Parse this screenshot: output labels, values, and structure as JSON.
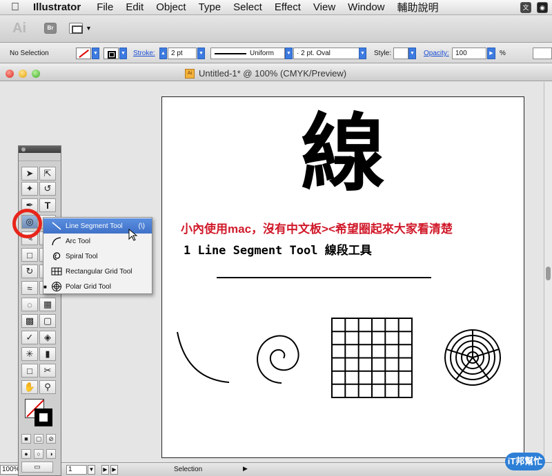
{
  "menubar": {
    "app_name": "Illustrator",
    "items": [
      "File",
      "Edit",
      "Object",
      "Type",
      "Select",
      "Effect",
      "View",
      "Window",
      "輔助說明"
    ]
  },
  "appbar": {
    "logo": "Ai",
    "bridge": "Br"
  },
  "controlbar": {
    "selection_status": "No Selection",
    "stroke_label": "Stroke:",
    "stroke_weight": "2 pt",
    "brush_label": "Uniform",
    "profile": "·   2 pt. Oval",
    "style_label": "Style:",
    "opacity_label": "Opacity:",
    "opacity_value": "100",
    "opacity_unit": "%"
  },
  "document": {
    "title": "Untitled-1* @ 100% (CMYK/Preview)",
    "icon": "Ai"
  },
  "artboard": {
    "big_char": "線",
    "red_text": "小內使用mac，沒有中文板><希望圈起來大家看清楚",
    "subtitle": "1 Line Segment Tool 線段工具"
  },
  "flyout": {
    "items": [
      {
        "label": "Line Segment Tool",
        "shortcut": "(\\)",
        "icon": "line-segment-icon",
        "selected": true
      },
      {
        "label": "Arc Tool",
        "shortcut": "",
        "icon": "arc-icon",
        "selected": false
      },
      {
        "label": "Spiral Tool",
        "shortcut": "",
        "icon": "spiral-icon",
        "selected": false
      },
      {
        "label": "Rectangular Grid Tool",
        "shortcut": "",
        "icon": "rect-grid-icon",
        "selected": false
      },
      {
        "label": "Polar Grid Tool",
        "shortcut": "",
        "icon": "polar-grid-icon",
        "selected": false
      }
    ]
  },
  "statusbar": {
    "zoom": "100%",
    "page": "1",
    "status": "Selection"
  },
  "watermark": {
    "text": "iT邦幫忙"
  },
  "colors": {
    "accent": "#3d7be0",
    "highlight_circle": "#e8251b",
    "annotation_text": "#d0192a"
  }
}
